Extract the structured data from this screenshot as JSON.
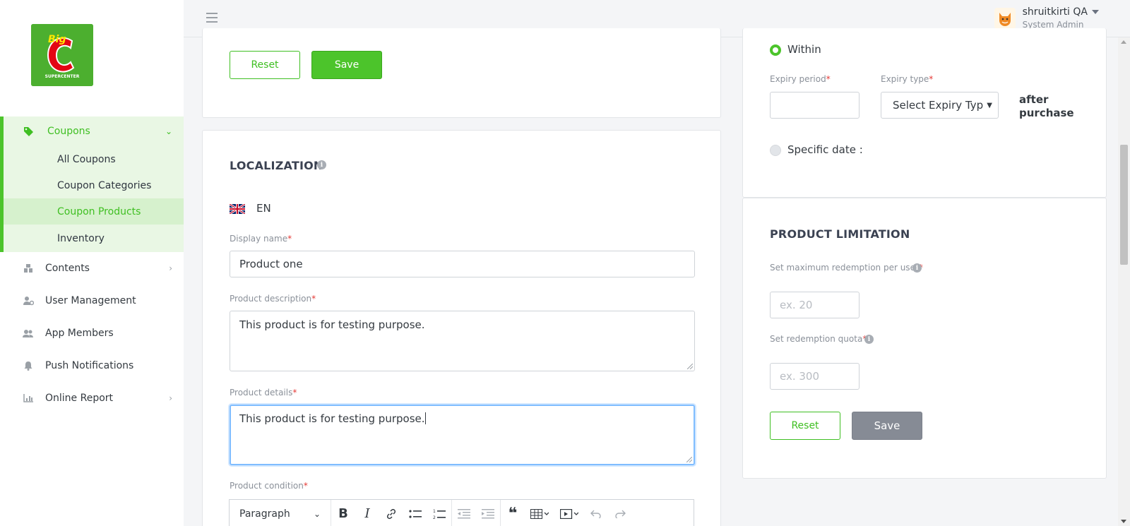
{
  "brand": {
    "logo_alt": "Big C Supercenter",
    "accent": "#4cc42b"
  },
  "sidebar": {
    "coupons": {
      "label": "Coupons",
      "icon": "tag-icon"
    },
    "coupons_children": [
      {
        "label": "All Coupons"
      },
      {
        "label": "Coupon Categories"
      },
      {
        "label": "Coupon Products",
        "active": true
      },
      {
        "label": "Inventory"
      }
    ],
    "items": [
      {
        "label": "Contents",
        "icon": "boxes-icon",
        "has_children": true
      },
      {
        "label": "User Management",
        "icon": "user-gear-icon"
      },
      {
        "label": "App Members",
        "icon": "users-icon"
      },
      {
        "label": "Push Notifications",
        "icon": "bell-icon"
      },
      {
        "label": "Online Report",
        "icon": "chart-icon",
        "has_children": true
      }
    ]
  },
  "topbar": {
    "user_name": "shruitkirti QA",
    "user_role": "System Admin"
  },
  "top_card": {
    "reset_label": "Reset",
    "save_label": "Save"
  },
  "localization": {
    "title": "LOCALIZATION",
    "language": "EN",
    "display_name": {
      "label": "Display name",
      "value": "Product one"
    },
    "product_description": {
      "label": "Product description",
      "value": "This product is for testing purpose."
    },
    "product_details": {
      "label": "Product details",
      "value": "This product is for testing purpose."
    },
    "product_condition": {
      "label": "Product condition"
    },
    "editor": {
      "format_select": "Paragraph"
    }
  },
  "expiry": {
    "within_label": "Within",
    "expiry_period_label": "Expiry period",
    "expiry_period_value": "",
    "expiry_type_label": "Expiry type",
    "expiry_type_value": "Select Expiry Typ",
    "after_purchase": "after purchase",
    "specific_date_label": "Specific date :",
    "selected": "within"
  },
  "product_limitation": {
    "title": "PRODUCT LIMITATION",
    "max_redemption_label": "Set maximum redemption per user",
    "max_redemption_placeholder": "ex. 20",
    "quota_label": "Set redemption quota",
    "quota_placeholder": "ex. 300",
    "reset_label": "Reset",
    "save_label": "Save"
  },
  "required_mark": "*"
}
